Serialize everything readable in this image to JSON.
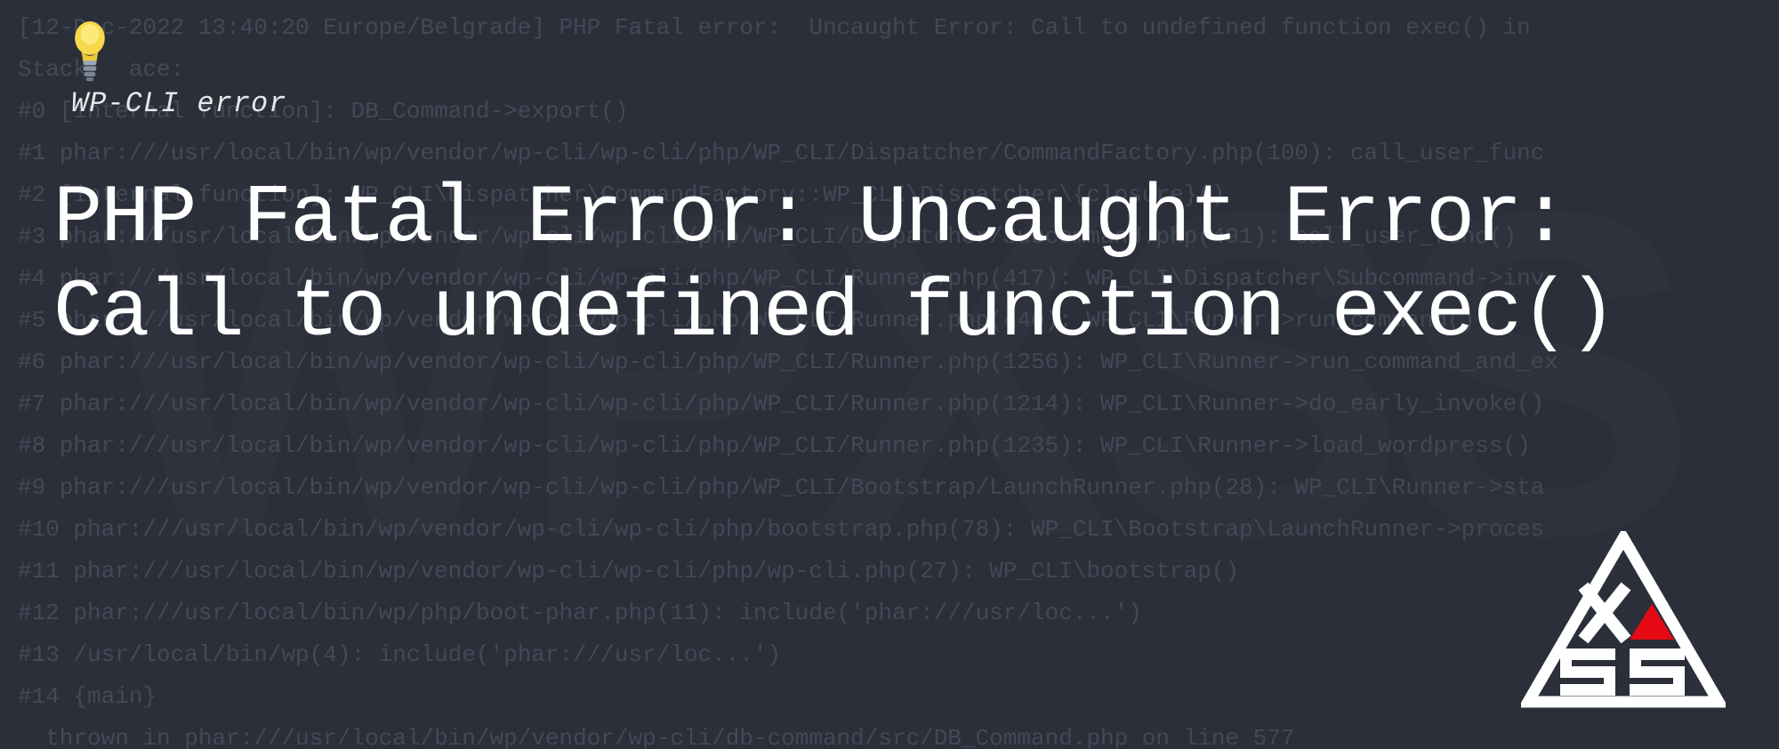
{
  "category": "WP-CLI error",
  "title": "PHP Fatal Error: Uncaught Error: Call to undefined function exec()",
  "watermark": "WPXSS",
  "background_code": {
    "line0": "[12-Dec-2022 13:40:20 Europe/Belgrade] PHP Fatal error:  Uncaught Error: Call to undefined function exec() in ",
    "line1": "Stack   ace:",
    "line2": "#0 [internal function]: DB_Command->export()",
    "line3": "#1 phar:///usr/local/bin/wp/vendor/wp-cli/wp-cli/php/WP_CLI/Dispatcher/CommandFactory.php(100): call_user_func",
    "line4": "#2 [internal function]: WP_CLI\\Dispatcher\\CommandFactory::WP_CLI\\Dispatcher\\{closure}()",
    "line5": "#3 phar:///usr/local/bin/wp/vendor/wp-cli/wp-cli/php/WP_CLI/Dispatcher/Subcommand.php(491): call_user_func()",
    "line6": "#4 phar:///usr/local/bin/wp/vendor/wp-cli/wp-cli/php/WP_CLI/Runner.php(417): WP_CLI\\Dispatcher\\Subcommand->inv",
    "line7": "#5 phar:///usr/local/bin/wp/vendor/wp-cli/wp-cli/php/WP_CLI/Runner.php(440): WP_CLI\\Runner->run_command()",
    "line8": "#6 phar:///usr/local/bin/wp/vendor/wp-cli/wp-cli/php/WP_CLI/Runner.php(1256): WP_CLI\\Runner->run_command_and_ex",
    "line9": "#7 phar:///usr/local/bin/wp/vendor/wp-cli/wp-cli/php/WP_CLI/Runner.php(1214): WP_CLI\\Runner->do_early_invoke()",
    "line10": "#8 phar:///usr/local/bin/wp/vendor/wp-cli/wp-cli/php/WP_CLI/Runner.php(1235): WP_CLI\\Runner->load_wordpress()",
    "line11": "#9 phar:///usr/local/bin/wp/vendor/wp-cli/wp-cli/php/WP_CLI/Bootstrap/LaunchRunner.php(28): WP_CLI\\Runner->sta",
    "line12": "#10 phar:///usr/local/bin/wp/vendor/wp-cli/wp-cli/php/bootstrap.php(78): WP_CLI\\Bootstrap\\LaunchRunner->proces",
    "line13": "#11 phar:///usr/local/bin/wp/vendor/wp-cli/wp-cli/php/wp-cli.php(27): WP_CLI\\bootstrap()",
    "line14": "#12 phar:///usr/local/bin/wp/php/boot-phar.php(11): include('phar:///usr/loc...')",
    "line15": "#13 /usr/local/bin/wp(4): include('phar:///usr/loc...')",
    "line16": "#14 {main}",
    "line17": "  thrown in phar:///usr/local/bin/wp/vendor/wp-cli/db-command/src/DB_Command.php on line 577"
  }
}
